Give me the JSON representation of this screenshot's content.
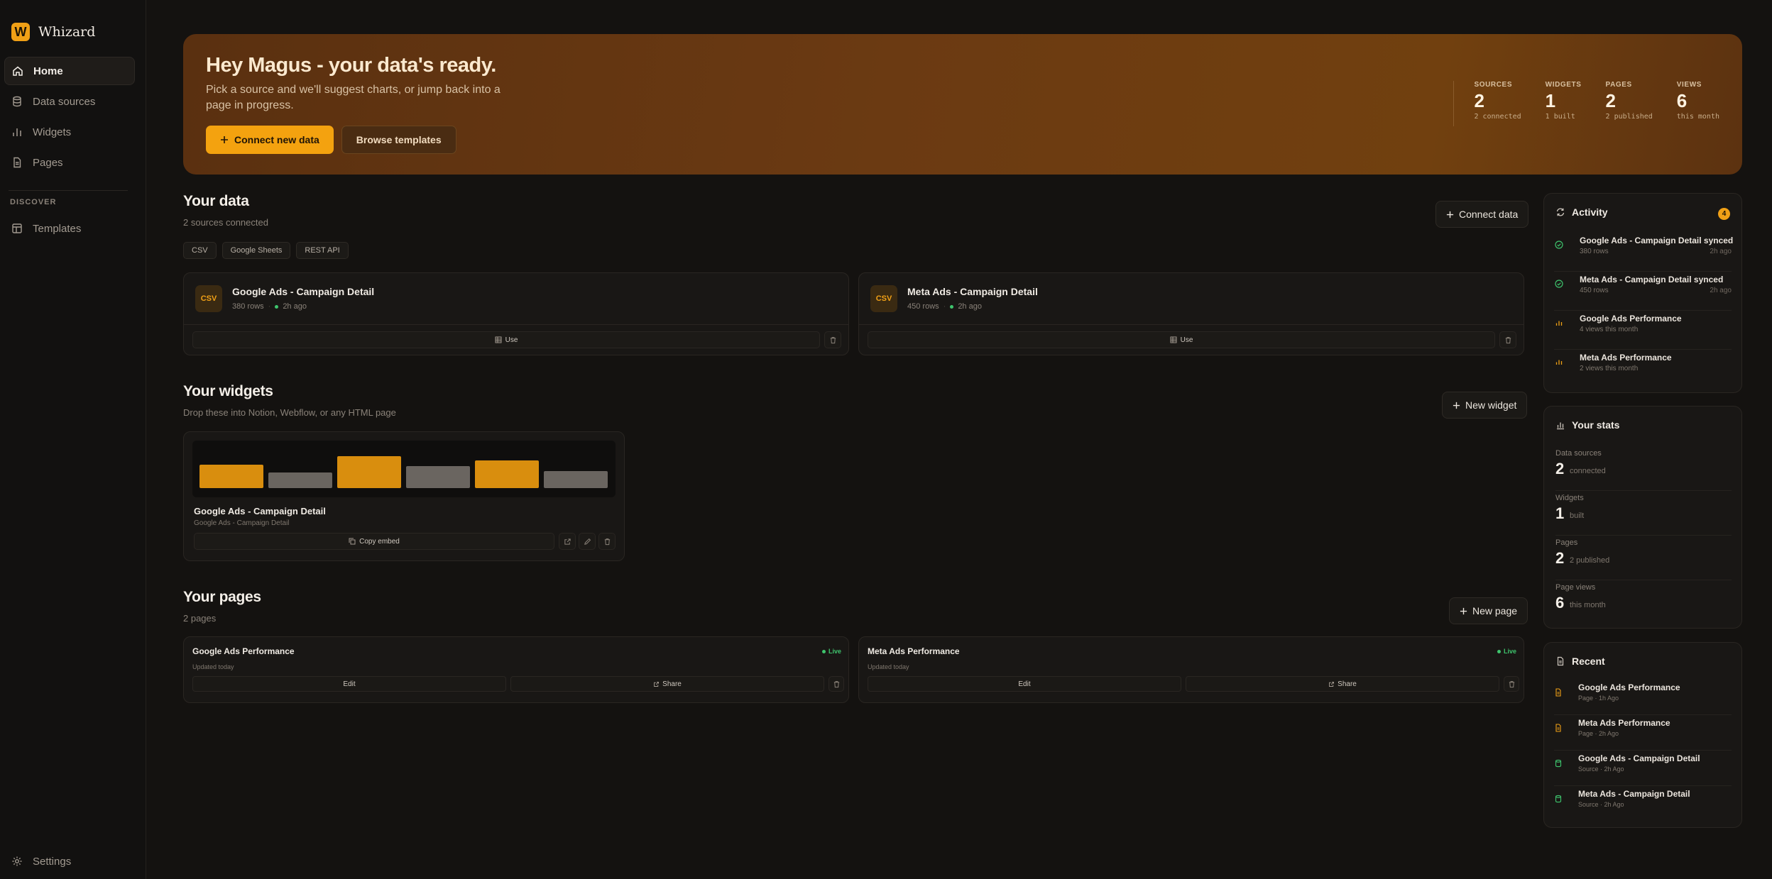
{
  "brand": {
    "logo_letter": "W",
    "name": "Whizard",
    "accent": "#f0a016"
  },
  "nav": {
    "items": [
      {
        "label": "Home",
        "icon": "home-icon"
      },
      {
        "label": "Data sources",
        "icon": "database-icon"
      },
      {
        "label": "Widgets",
        "icon": "bar-chart-icon"
      },
      {
        "label": "Pages",
        "icon": "file-icon"
      }
    ],
    "section_label": "DISCOVER",
    "discover_items": [
      {
        "label": "Templates",
        "icon": "template-icon"
      }
    ],
    "settings_label": "Settings"
  },
  "hero": {
    "title": "Hey Magus - your data's ready.",
    "subtitle": "Pick a source and we'll suggest charts, or jump back into a page in progress.",
    "primary_button": "Connect new data",
    "secondary_button": "Browse templates",
    "stats": [
      {
        "label": "SOURCES",
        "value": "2",
        "sub": "2 connected"
      },
      {
        "label": "WIDGETS",
        "value": "1",
        "sub": "1 built"
      },
      {
        "label": "PAGES",
        "value": "2",
        "sub": "2 published"
      },
      {
        "label": "VIEWS",
        "value": "6",
        "sub": "this month"
      }
    ]
  },
  "your_data": {
    "title": "Your data",
    "subtitle": "2 sources connected",
    "button": "Connect data",
    "chips": [
      "CSV",
      "Google Sheets",
      "REST API"
    ],
    "sources": [
      {
        "badge": "CSV",
        "name": "Google Ads - Campaign Detail",
        "rows": "380 rows",
        "time": "2h ago",
        "use_label": "Use"
      },
      {
        "badge": "CSV",
        "name": "Meta Ads - Campaign Detail",
        "rows": "450 rows",
        "time": "2h ago",
        "use_label": "Use"
      }
    ]
  },
  "your_widgets": {
    "title": "Your widgets",
    "subtitle": "Drop these into Notion, Webflow, or any HTML page",
    "button": "New widget",
    "widgets": [
      {
        "title": "Google Ads - Campaign Detail",
        "source": "Google Ads - Campaign Detail",
        "copy_label": "Copy embed"
      }
    ]
  },
  "your_pages": {
    "title": "Your pages",
    "subtitle": "2 pages",
    "button": "New page",
    "pages": [
      {
        "title": "Google Ads Performance",
        "status": "Live",
        "updated": "Updated today",
        "edit_label": "Edit",
        "share_label": "Share"
      },
      {
        "title": "Meta Ads Performance",
        "status": "Live",
        "updated": "Updated today",
        "edit_label": "Edit",
        "share_label": "Share"
      }
    ]
  },
  "activity": {
    "title": "Activity",
    "count": "4",
    "items": [
      {
        "icon": "check-circle-icon",
        "title": "Google Ads - Campaign Detail synced",
        "sub": "380 rows",
        "time": "2h ago"
      },
      {
        "icon": "check-circle-icon",
        "title": "Meta Ads - Campaign Detail synced",
        "sub": "450 rows",
        "time": "2h ago"
      },
      {
        "icon": "bar-chart-icon",
        "title": "Google Ads Performance",
        "sub": "4 views this month",
        "time": ""
      },
      {
        "icon": "bar-chart-icon",
        "title": "Meta Ads Performance",
        "sub": "2 views this month",
        "time": ""
      }
    ]
  },
  "your_stats": {
    "title": "Your stats",
    "items": [
      {
        "label": "Data sources",
        "value": "2",
        "sub": "connected"
      },
      {
        "label": "Widgets",
        "value": "1",
        "sub": "built"
      },
      {
        "label": "Pages",
        "value": "2",
        "sub": "2 published"
      },
      {
        "label": "Page views",
        "value": "6",
        "sub": "this month"
      }
    ]
  },
  "recent": {
    "title": "Recent",
    "items": [
      {
        "icon": "file-icon",
        "title": "Google Ads Performance",
        "sub": "Page · 1h Ago"
      },
      {
        "icon": "file-icon",
        "title": "Meta Ads Performance",
        "sub": "Page · 2h Ago"
      },
      {
        "icon": "database-icon",
        "title": "Google Ads - Campaign Detail",
        "sub": "Source · 2h Ago"
      },
      {
        "icon": "database-icon",
        "title": "Meta Ads - Campaign Detail",
        "sub": "Source · 2h Ago"
      }
    ]
  },
  "colors": {
    "accent": "#f0a016",
    "success": "#3ec46d",
    "bar_highlight": "#d98e0e",
    "bar_muted": "#6a6560"
  }
}
